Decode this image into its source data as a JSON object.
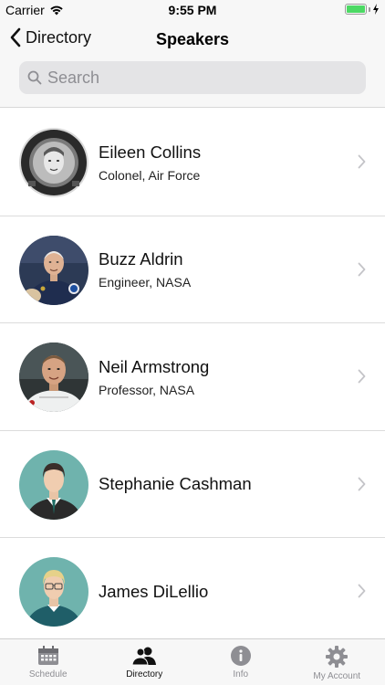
{
  "status_bar": {
    "carrier": "Carrier",
    "time": "9:55 PM",
    "battery_color": "#4cd964"
  },
  "nav": {
    "back_label": "Directory",
    "title": "Speakers"
  },
  "search": {
    "placeholder": "Search",
    "value": ""
  },
  "speakers": [
    {
      "name": "Eileen Collins",
      "title": "Colonel, Air Force",
      "avatar": "photo-astronaut-helmet"
    },
    {
      "name": "Buzz Aldrin",
      "title": "Engineer, NASA",
      "avatar": "photo-astronaut-suit"
    },
    {
      "name": "Neil Armstrong",
      "title": "Professor, NASA",
      "avatar": "photo-astronaut-portrait"
    },
    {
      "name": "Stephanie Cashman",
      "title": "",
      "avatar": "avatar-placeholder-dark-hair"
    },
    {
      "name": "James DiLellio",
      "title": "",
      "avatar": "avatar-placeholder-blond-glasses"
    }
  ],
  "tabs": [
    {
      "label": "Schedule",
      "icon": "calendar-icon",
      "active": false
    },
    {
      "label": "Directory",
      "icon": "people-icon",
      "active": true
    },
    {
      "label": "Info",
      "icon": "info-icon",
      "active": false
    },
    {
      "label": "My Account",
      "icon": "gear-icon",
      "active": false
    }
  ],
  "colors": {
    "avatar_background": "#6fb3ad",
    "tab_inactive": "#8e8e93",
    "tab_active": "#111111"
  }
}
